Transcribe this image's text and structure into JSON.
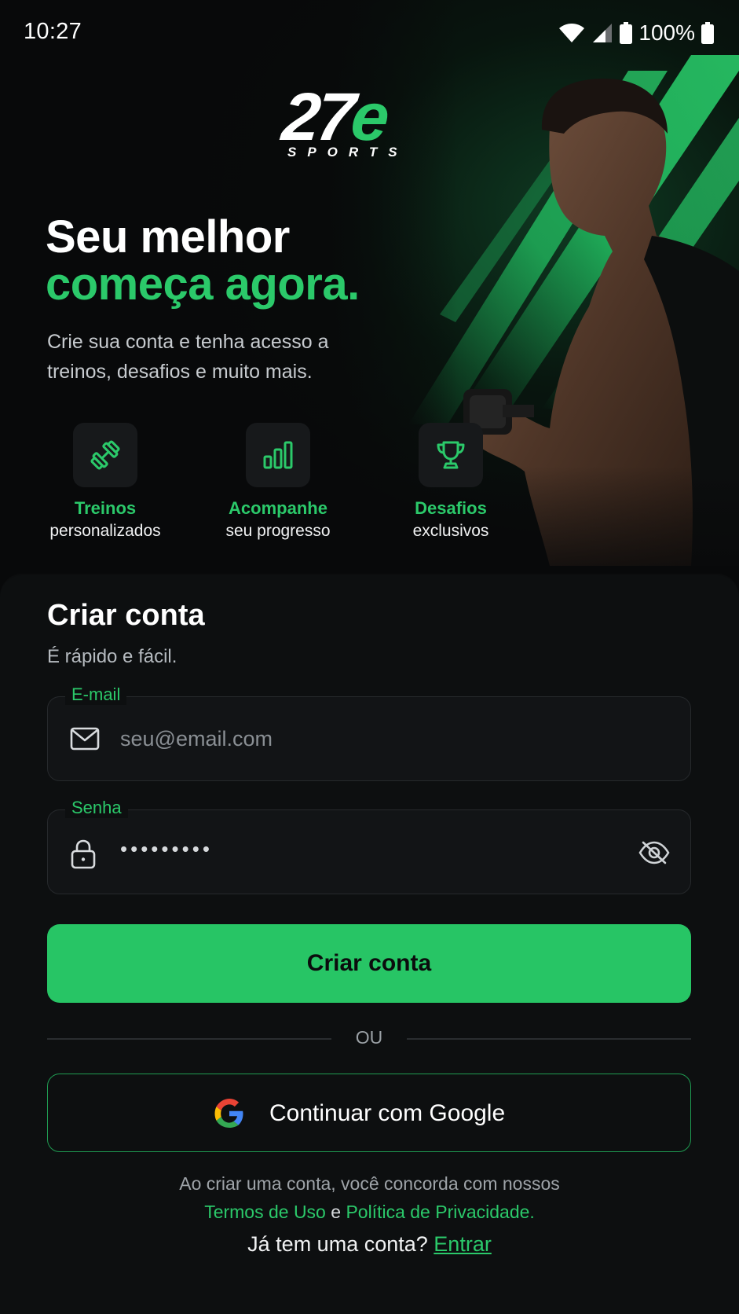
{
  "status_bar": {
    "time": "10:27",
    "battery_percent": "100%",
    "icons": [
      "wifi-icon",
      "signal-icon",
      "battery-icon"
    ]
  },
  "brand": {
    "logo_main": "27",
    "logo_accent": "e",
    "logo_sub": "SPORTS",
    "accent_color": "#2bc96a"
  },
  "hero": {
    "headline_line1": "Seu melhor",
    "headline_line2": "começa agora.",
    "subtitle": "Crie sua conta e tenha acesso a treinos, desafios e muito mais."
  },
  "features": [
    {
      "icon": "dumbbell-icon",
      "title": "Treinos",
      "subtitle": "personalizados"
    },
    {
      "icon": "bar-chart-icon",
      "title": "Acompanhe",
      "subtitle": "seu progresso"
    },
    {
      "icon": "trophy-icon",
      "title": "Desafios",
      "subtitle": "exclusivos"
    }
  ],
  "form": {
    "title": "Criar conta",
    "subtitle": "É rápido e fácil.",
    "email": {
      "label": "E-mail",
      "placeholder": "seu@email.com",
      "value": "",
      "icon": "mail-icon"
    },
    "password": {
      "label": "Senha",
      "masked_value": "•••••••••",
      "icon": "lock-icon",
      "toggle_icon": "eye-off-icon"
    },
    "submit_label": "Criar conta",
    "divider_text": "OU",
    "google_label": "Continuar com Google"
  },
  "legal": {
    "text": "Ao criar uma conta, você concorda com nossos",
    "terms_link": "Termos de Uso",
    "and": "e",
    "privacy_link": "Política de Privacidade."
  },
  "login": {
    "prompt": "Já tem uma conta?",
    "link": "Entrar"
  },
  "colors": {
    "background": "#08090a",
    "card": "#0d0f10",
    "accent": "#2bc96a",
    "button": "#27c565"
  }
}
